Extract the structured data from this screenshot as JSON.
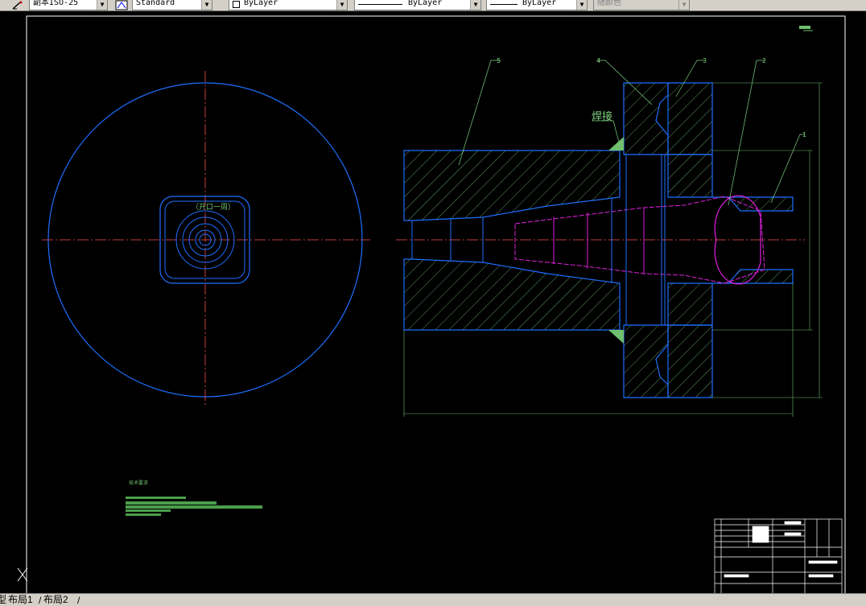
{
  "toolbar": {
    "dimstyle": "副本ISO-25",
    "textstyle": "Standard",
    "layer": "ByLayer",
    "linetype": "ByLayer",
    "lineweight": "ByLayer",
    "plotstyle": "随颜色"
  },
  "drawing": {
    "part_numbers": [
      "5",
      "4",
      "3",
      "2",
      "1"
    ],
    "weld_label": "焊接",
    "circle_view_label": "（开口一周）",
    "notes_title": "技术要求"
  },
  "tabs": {
    "model": "型",
    "layout1": "布局1",
    "layout2": "布局2"
  },
  "colors": {
    "outline": "#1e6fff",
    "hatch": "#6fbf6f",
    "centerline": "#ff5050",
    "inner": "#e020e0",
    "leader": "#7fd07f",
    "border": "#ffffff",
    "background": "#000000"
  }
}
